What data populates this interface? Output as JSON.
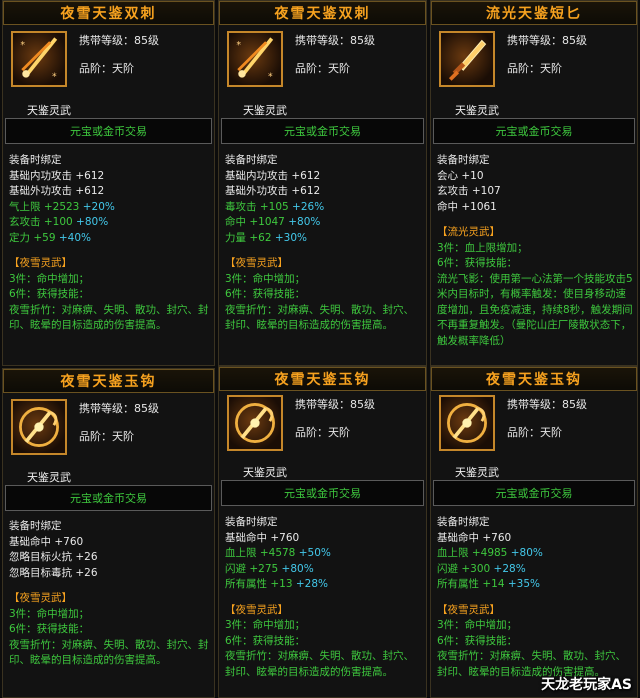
{
  "cards": [
    {
      "title": "夜雪天鉴双刺",
      "carry_level": "携带等级：85级",
      "rank": "品阶：天阶",
      "class": "天鉴灵武",
      "trade": "元宝或金币交易",
      "icon": "dual-dagger-icon",
      "bind": "装备时绑定",
      "stats": [
        {
          "label": "基础内功攻击",
          "value": "+612",
          "bonus": ""
        },
        {
          "label": "基础外功攻击",
          "value": "+612",
          "bonus": ""
        },
        {
          "label": "气上限",
          "value": "+2523",
          "bonus": "+20%",
          "hl": true
        },
        {
          "label": "玄攻击",
          "value": "+100",
          "bonus": "+80%",
          "hl": true
        },
        {
          "label": "定力",
          "value": "+59",
          "bonus": "+40%",
          "hl": true
        }
      ],
      "set_name": "【夜雪灵武】",
      "set_lines": [
        "3件：命中增加；",
        "6件：获得技能："
      ],
      "set_desc": "夜雪折竹：对麻痹、失明、散功、封穴、封印、眩晕的目标造成的伤害提高。"
    },
    {
      "title": "夜雪天鉴双刺",
      "carry_level": "携带等级：85级",
      "rank": "品阶：天阶",
      "class": "天鉴灵武",
      "trade": "元宝或金币交易",
      "icon": "dual-dagger-icon",
      "bind": "装备时绑定",
      "stats": [
        {
          "label": "基础内功攻击",
          "value": "+612",
          "bonus": ""
        },
        {
          "label": "基础外功攻击",
          "value": "+612",
          "bonus": ""
        },
        {
          "label": "毒攻击",
          "value": "+105",
          "bonus": "+26%",
          "hl": true
        },
        {
          "label": "命中",
          "value": "+1047",
          "bonus": "+80%",
          "hl": true
        },
        {
          "label": "力量",
          "value": "+62",
          "bonus": "+30%",
          "hl": true
        }
      ],
      "set_name": "【夜雪灵武】",
      "set_lines": [
        "3件：命中增加；",
        "6件：获得技能："
      ],
      "set_desc": "夜雪折竹：对麻痹、失明、散功、封穴、封印、眩晕的目标造成的伤害提高。"
    },
    {
      "title": "流光天鉴短匕",
      "carry_level": "携带等级：85级",
      "rank": "品阶：天阶",
      "class": "天鉴灵武",
      "trade": "元宝或金币交易",
      "icon": "short-dagger-icon",
      "bind": "装备时绑定",
      "stats": [
        {
          "label": "会心",
          "value": "+10",
          "bonus": ""
        },
        {
          "label": "玄攻击",
          "value": "+107",
          "bonus": ""
        },
        {
          "label": "命中",
          "value": "+1061",
          "bonus": ""
        }
      ],
      "set_name": "【流光灵武】",
      "set_lines": [
        "3件：血上限增加；",
        "6件：获得技能："
      ],
      "set_desc": "流光飞影：使用第一心法第一个技能攻击5米内目标时，有概率触发：使目身移动速度增加，且免疫减速，持续8秒，触发期间不再重复触发。（曼陀山庄厂陵散状态下，触发概率降低）"
    },
    {
      "title": "夜雪天鉴玉钩",
      "carry_level": "携带等级：85级",
      "rank": "品阶：天阶",
      "class": "天鉴灵武",
      "trade": "元宝或金币交易",
      "icon": "jade-hook-icon",
      "bind": "装备时绑定",
      "stats": [
        {
          "label": "基础命中",
          "value": "+760",
          "bonus": ""
        },
        {
          "label": "忽略目标火抗",
          "value": "+26",
          "bonus": ""
        },
        {
          "label": "忽略目标毒抗",
          "value": "+26",
          "bonus": ""
        }
      ],
      "set_name": "【夜雪灵武】",
      "set_lines": [
        "3件：命中增加；",
        "6件：获得技能："
      ],
      "set_desc": "夜雪折竹：对麻痹、失明、散功、封穴、封印、眩晕的目标造成的伤害提高。"
    },
    {
      "title": "夜雪天鉴玉钩",
      "carry_level": "携带等级：85级",
      "rank": "品阶：天阶",
      "class": "天鉴灵武",
      "trade": "元宝或金币交易",
      "icon": "jade-hook-icon",
      "bind": "装备时绑定",
      "stats": [
        {
          "label": "基础命中",
          "value": "+760",
          "bonus": ""
        },
        {
          "label": "血上限",
          "value": "+4578",
          "bonus": "+50%",
          "hl": true
        },
        {
          "label": "闪避",
          "value": "+275",
          "bonus": "+80%",
          "hl": true
        },
        {
          "label": "所有属性",
          "value": "+13",
          "bonus": "+28%",
          "hl": true
        }
      ],
      "set_name": "【夜雪灵武】",
      "set_lines": [
        "3件：命中增加；",
        "6件：获得技能："
      ],
      "set_desc": "夜雪折竹：对麻痹、失明、散功、封穴、封印、眩晕的目标造成的伤害提高。"
    },
    {
      "title": "夜雪天鉴玉钩",
      "carry_level": "携带等级：85级",
      "rank": "品阶：天阶",
      "class": "天鉴灵武",
      "trade": "元宝或金币交易",
      "icon": "jade-hook-icon",
      "bind": "装备时绑定",
      "stats": [
        {
          "label": "基础命中",
          "value": "+760",
          "bonus": ""
        },
        {
          "label": "血上限",
          "value": "+4985",
          "bonus": "+80%",
          "hl": true
        },
        {
          "label": "闪避",
          "value": "+300",
          "bonus": "+28%",
          "hl": true
        },
        {
          "label": "所有属性",
          "value": "+14",
          "bonus": "+35%",
          "hl": true
        }
      ],
      "set_name": "【夜雪灵武】",
      "set_lines": [
        "3件：命中增加；",
        "6件：获得技能："
      ],
      "set_desc": "夜雪折竹：对麻痹、失明、散功、封穴、封印、眩晕的目标造成的伤害提高。"
    }
  ],
  "watermark": "天龙老玩家AS"
}
